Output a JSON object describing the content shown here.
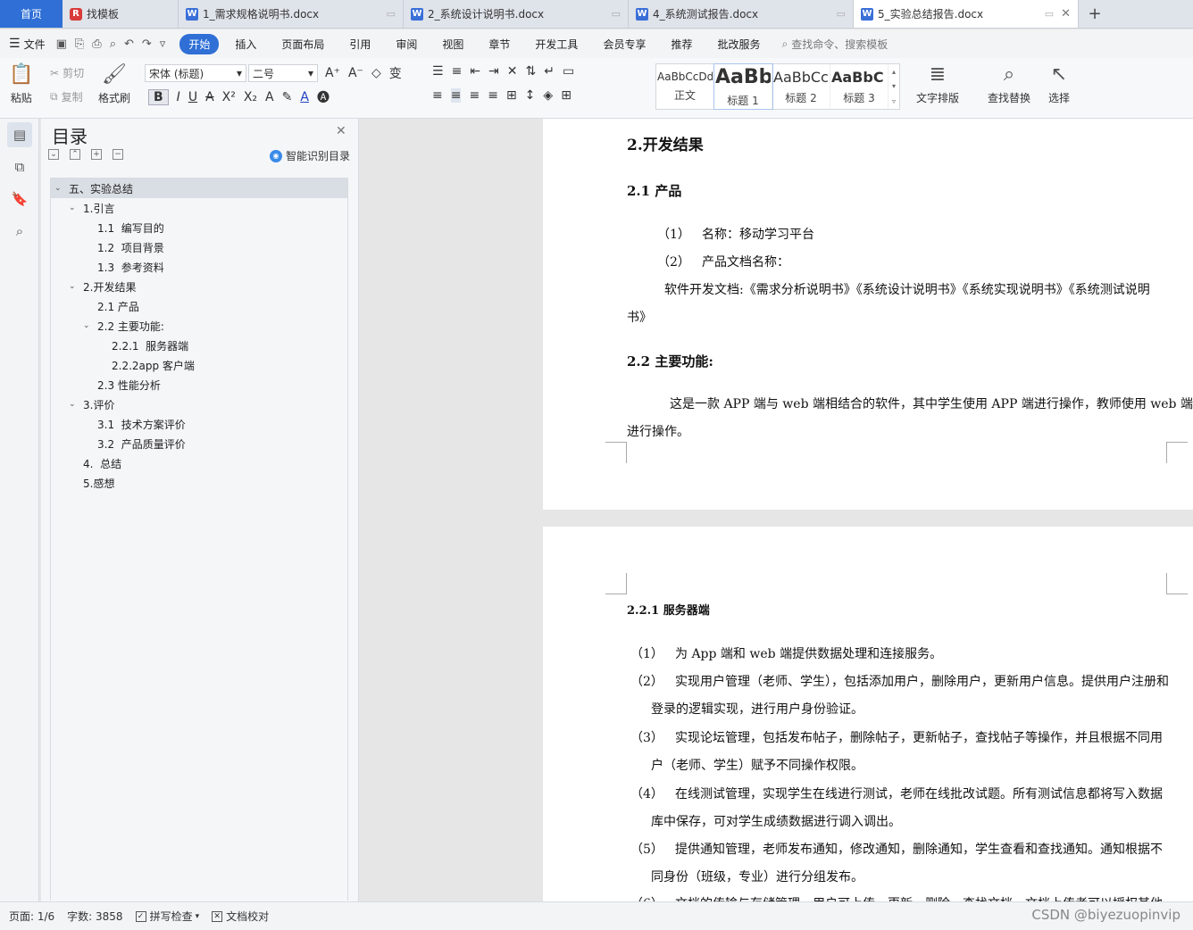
{
  "tabs": {
    "home": "首页",
    "template": "找模板",
    "docs": [
      {
        "label": "1_需求规格说明书.docx"
      },
      {
        "label": "2_系统设计说明书.docx"
      },
      {
        "label": "4_系统测试报告.docx"
      },
      {
        "label": "5_实验总结报告.docx"
      }
    ],
    "add": "+"
  },
  "menu": {
    "file": "文件",
    "items": [
      "开始",
      "插入",
      "页面布局",
      "引用",
      "审阅",
      "视图",
      "章节",
      "开发工具",
      "会员专享",
      "推荐",
      "批改服务"
    ],
    "search_placeholder": "查找命令、搜索模板"
  },
  "ribbon": {
    "paste": "粘贴",
    "cut": "剪切",
    "copy": "复制",
    "format_painter": "格式刷",
    "font_name": "宋体 (标题)",
    "font_size": "二号",
    "styles": [
      {
        "sample": "AaBbCcDd",
        "name": "正文"
      },
      {
        "sample": "AaBb",
        "name": "标题 1"
      },
      {
        "sample": "AaBbCcl",
        "name": "标题 2"
      },
      {
        "sample": "AaBbC",
        "name": "标题 3"
      }
    ],
    "text_layout": "文字排版",
    "find_replace": "查找替换",
    "select": "选择"
  },
  "toc": {
    "title": "目录",
    "smart": "智能识别目录",
    "items": [
      {
        "label": "五、实验总结"
      },
      {
        "label": "1.引言"
      },
      {
        "label": "1.1  编写目的"
      },
      {
        "label": "1.2  项目背景"
      },
      {
        "label": "1.3  参考资料"
      },
      {
        "label": "2.开发结果"
      },
      {
        "label": "2.1 产品"
      },
      {
        "label": "2.2 主要功能:"
      },
      {
        "label": "2.2.1  服务器端"
      },
      {
        "label": "2.2.2app 客户端"
      },
      {
        "label": "2.3 性能分析"
      },
      {
        "label": "3.评价"
      },
      {
        "label": "3.1  技术方案评价"
      },
      {
        "label": "3.2  产品质量评价"
      },
      {
        "label": "4.  总结"
      },
      {
        "label": "5.感想"
      }
    ]
  },
  "document": {
    "page1": {
      "h_dev": "2.开发结果",
      "h_product": "2.1 产品",
      "item1_num": "（1）",
      "item1_text": "名称：移动学习平台",
      "item2_num": "（2）",
      "item2_text": "产品文档名称：",
      "docs_line1": "软件开发文档:《需求分析说明书》《系统设计说明书》《系统实现说明书》《系统测试说明",
      "docs_line2": "书》",
      "h_func": "2.2 主要功能:",
      "func_line1": "这是一款 APP 端与 web 端相结合的软件，其中学生使用 APP 端进行操作，教师使用 web 端",
      "func_line2": "进行操作。"
    },
    "page2": {
      "h_server": "2.2.1  服务器端",
      "list": [
        {
          "num": "（1）",
          "line1": "为 App 端和 web 端提供数据处理和连接服务。",
          "line2": ""
        },
        {
          "num": "（2）",
          "line1": "实现用户管理（老师、学生），包括添加用户，删除用户，更新用户信息。提供用户注册和",
          "line2": "登录的逻辑实现，进行用户身份验证。"
        },
        {
          "num": "（3）",
          "line1": "实现论坛管理，包括发布帖子，删除帖子，更新帖子，查找帖子等操作，并且根据不同用",
          "line2": "户（老师、学生）赋予不同操作权限。"
        },
        {
          "num": "（4）",
          "line1": "在线测试管理，实现学生在线进行测试，老师在线批改试题。所有测试信息都将写入数据",
          "line2": "库中保存，可对学生成绩数据进行调入调出。"
        },
        {
          "num": "（5）",
          "line1": "提供通知管理，老师发布通知，修改通知，删除通知，学生查看和查找通知。通知根据不",
          "line2": "同身份（班级，专业）进行分组发布。"
        },
        {
          "num": "（6）",
          "line1": "文档的传输与存储管理，用户可上传、更新、删除、查找文档，文档上传者可以授权其他",
          "line2": ""
        }
      ]
    }
  },
  "status": {
    "page": "页面: 1/6",
    "words": "字数: 3858",
    "spell": "拼写检查",
    "proof": "文档校对"
  },
  "watermark": "CSDN @biyezuopinvip"
}
